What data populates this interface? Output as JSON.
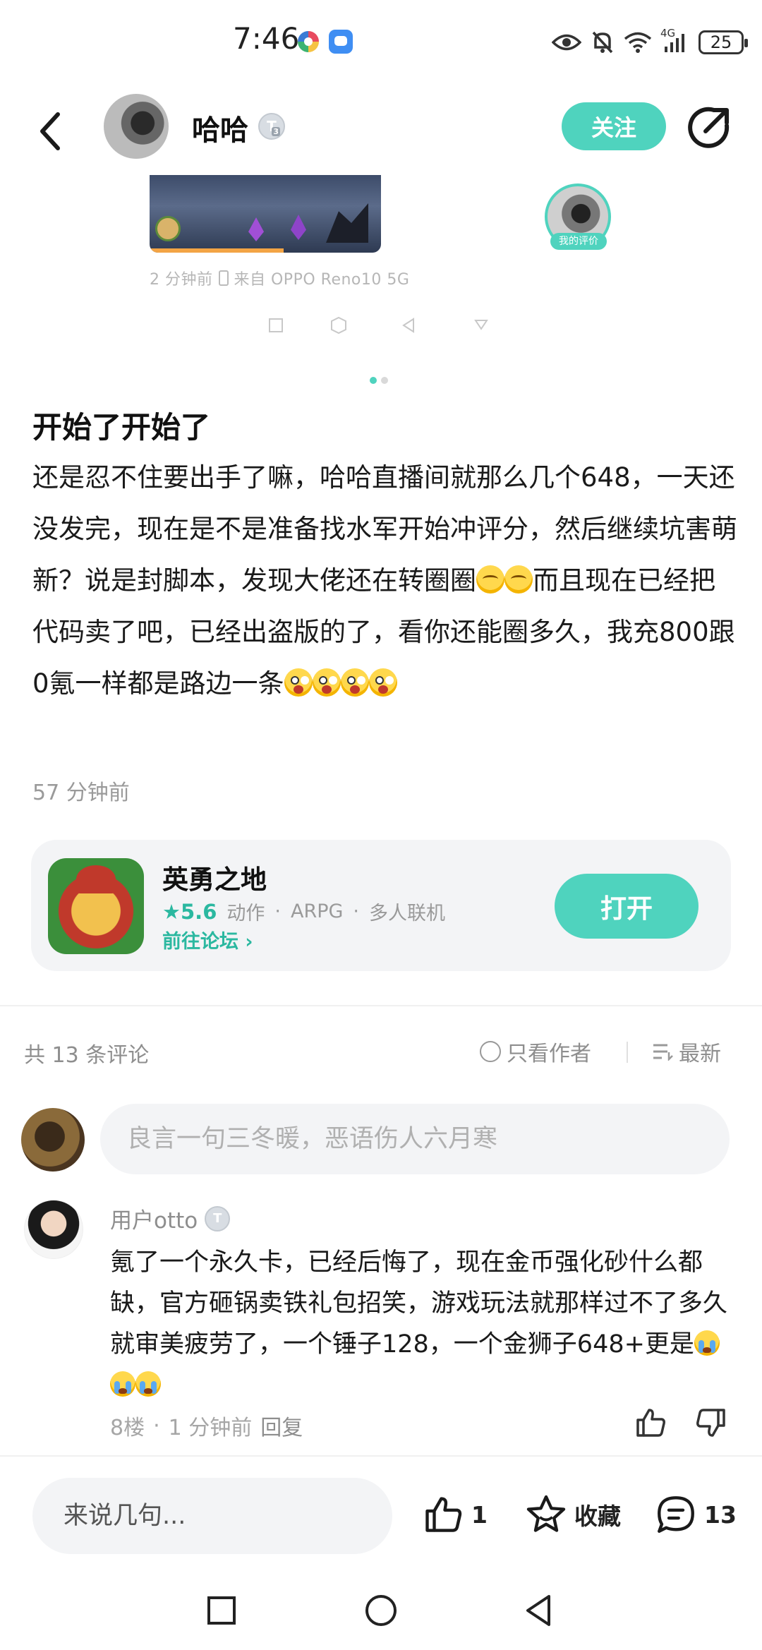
{
  "status_bar": {
    "time": "7:46",
    "network": "4G",
    "battery": "25",
    "icons": [
      "eye-icon",
      "mute-icon",
      "wifi-icon",
      "signal-icon",
      "battery-icon"
    ]
  },
  "header": {
    "user_name": "哈哈",
    "level_badge": "T",
    "level_sub": "3",
    "follow_label": "关注",
    "icons": [
      "back-icon",
      "share-icon"
    ]
  },
  "post_media": {
    "my_rating_label": "我的评价",
    "meta_time": "2 分钟前",
    "meta_device": "来自 OPPO Reno10 5G",
    "carousel_total": 2,
    "carousel_active": 1
  },
  "post": {
    "title": "开始了开始了",
    "body_part1": "还是忍不住要出手了嘛，哈哈直播间就那么几个648，一天还没发完，现在是不是准备找水军开始冲评分，然后继续坑害萌新？说是封脚本，发现大佬还在转圈圈",
    "body_part2": "而且现在已经把代码卖了吧，已经出盗版的了，看你还能圈多久，我充800跟0氪一样都是路边一条",
    "time": "57 分钟前"
  },
  "game_card": {
    "name": "英勇之地",
    "score": "★5.6",
    "tags": [
      "动作",
      "ARPG",
      "多人联机"
    ],
    "tag_sep": "·",
    "forum_link": "前往论坛 ›",
    "open_label": "打开"
  },
  "comments": {
    "count_label": "共 13 条评论",
    "only_author": "只看作者",
    "sort_label": "最新",
    "input_placeholder": "良言一句三冬暖，恶语伤人六月寒",
    "items": [
      {
        "user": "用户otto",
        "level": "T",
        "text": "氪了一个永久卡，已经后悔了，现在金币强化砂什么都缺，官方砸锅卖铁礼包招笑，游戏玩法就那样过不了多久就审美疲劳了，一个锤子128，一个金狮子648+更是",
        "floor": "8楼",
        "dot": "·",
        "time": "1 分钟前",
        "reply": "回复"
      }
    ]
  },
  "bottom_bar": {
    "input_placeholder": "来说几句...",
    "like_count": "1",
    "favorite_label": "收藏",
    "comment_count": "13"
  },
  "colors": {
    "accent": "#4fd3be",
    "accent_text": "#2bb8a0",
    "muted_text": "#8e8e8e",
    "card_bg": "#f3f4f6"
  }
}
